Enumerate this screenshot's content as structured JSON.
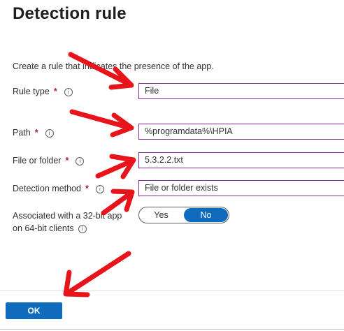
{
  "header": {
    "title": "Detection rule"
  },
  "description": "Create a rule that indicates the presence of the app.",
  "form": {
    "rule_type": {
      "label": "Rule type",
      "required_mark": "*",
      "value": "File"
    },
    "path": {
      "label": "Path",
      "required_mark": "*",
      "value": "%programdata%\\HPIA"
    },
    "file_or_folder": {
      "label": "File or folder",
      "required_mark": "*",
      "value": "5.3.2.2.txt"
    },
    "detection_method": {
      "label": "Detection method",
      "required_mark": "*",
      "value": "File or folder exists"
    },
    "associated_32bit": {
      "label_line1": "Associated with a 32-bit app",
      "label_line2": "on 64-bit clients",
      "options": [
        "Yes",
        "No"
      ],
      "selected": "No"
    }
  },
  "footer": {
    "ok_label": "OK"
  },
  "icons": {
    "info": "info-icon",
    "annotation": "red-arrow-icon"
  },
  "colors": {
    "accent": "#0f6cbd",
    "required": "#a4262c",
    "field_border": "#8a2a9c",
    "annotation_arrow": "#e8141b"
  }
}
